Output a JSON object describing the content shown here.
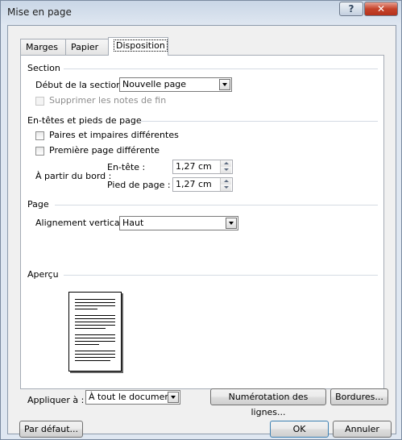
{
  "window": {
    "title": "Mise en page"
  },
  "tabs": [
    {
      "label": "Marges"
    },
    {
      "label": "Papier"
    },
    {
      "label": "Disposition"
    }
  ],
  "section": {
    "heading": "Section",
    "start_label": "Début de la section :",
    "start_value": "Nouvelle page",
    "suppress_endnotes_label": "Supprimer les notes de fin"
  },
  "headers_footers": {
    "heading": "En-têtes et pieds de page",
    "odd_even_label": "Paires et impaires différentes",
    "first_page_label": "Première page différente",
    "from_edge_label": "À partir du bord :",
    "header_label": "En-tête :",
    "header_value": "1,27 cm",
    "footer_label": "Pied de page :",
    "footer_value": "1,27 cm"
  },
  "page": {
    "heading": "Page",
    "vertical_alignment_label": "Alignement vertical :",
    "vertical_alignment_value": "Haut"
  },
  "preview": {
    "heading": "Aperçu"
  },
  "apply": {
    "label": "Appliquer à :",
    "value": "À tout le document",
    "line_numbers_button": "Numérotation des lignes...",
    "borders_button": "Bordures..."
  },
  "footer_buttons": {
    "default": "Par défaut...",
    "ok": "OK",
    "cancel": "Annuler"
  }
}
